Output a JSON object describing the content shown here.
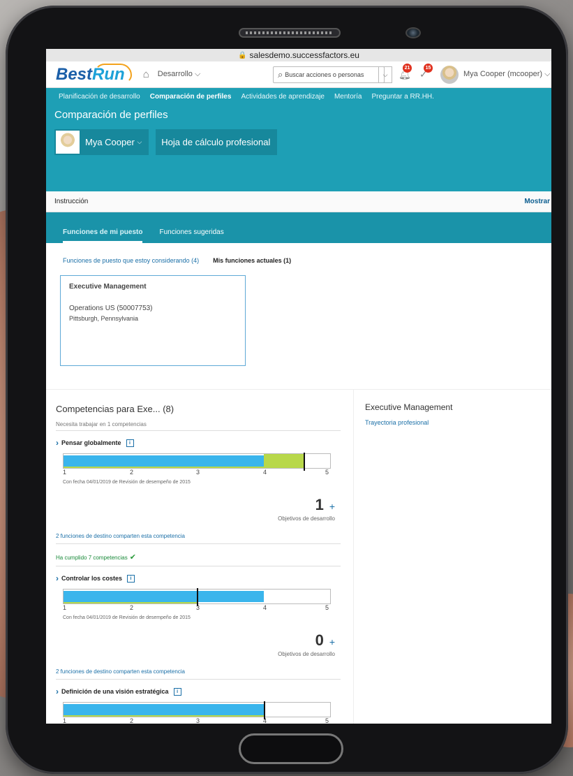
{
  "browser": {
    "url": "salesdemo.successfactors.eu"
  },
  "shell": {
    "logo_main": "Best",
    "logo_run": "Run",
    "module": "Desarrollo",
    "search_placeholder": "Buscar acciones o personas",
    "notifications_count": "21",
    "todos_count": "15",
    "user": "Mya Cooper (mcooper)"
  },
  "nav": {
    "items": [
      {
        "label": "Planificación de desarrollo"
      },
      {
        "label": "Comparación de perfiles"
      },
      {
        "label": "Actividades de aprendizaje"
      },
      {
        "label": "Mentoría"
      },
      {
        "label": "Preguntar a RR.HH."
      }
    ]
  },
  "header": {
    "title": "Comparación de perfiles",
    "person": "Mya Cooper",
    "worksheet": "Hoja de cálculo profesional"
  },
  "instruction": {
    "label": "Instrucción",
    "action": "Mostrar"
  },
  "tabs": [
    {
      "label": "Funciones de mi puesto"
    },
    {
      "label": "Funciones sugeridas"
    }
  ],
  "roles": {
    "considering": "Funciones de puesto que estoy considerando (4)",
    "current": "Mis funciones actuales (1)",
    "card": {
      "title": "Executive Management",
      "org": "Operations US (50007753)",
      "location": "Pittsburgh, Pennsylvania"
    }
  },
  "competencies": {
    "title": "Competencias para Exe...  (8)",
    "needs_work": "Necesita trabajar en 1 competencias",
    "met": "Ha cumplido 7 competencias",
    "scale": [
      "1",
      "2",
      "3",
      "4",
      "5"
    ],
    "items": [
      {
        "name": "Pensar globalmente",
        "rating": 4,
        "expected": 4.6,
        "dated": "Con fecha 04/01/2019 de Revisión de desempeño de 2015",
        "objectives": "1",
        "objectives_label": "Objetivos de desarrollo",
        "shared": "2 funciones de destino comparten esta competencia"
      },
      {
        "name": "Controlar los costes",
        "rating": 4,
        "expected": 3,
        "dated": "Con fecha 04/01/2019 de Revisión de desempeño de 2015",
        "objectives": "0",
        "objectives_label": "Objetivos de desarrollo",
        "shared": "2 funciones de destino comparten esta competencia"
      },
      {
        "name": "Definición de una visión estratégica",
        "rating": 4,
        "expected": 4
      }
    ]
  },
  "side": {
    "title": "Executive Management",
    "link": "Trayectoria profesional"
  },
  "colors": {
    "brand_teal": "#1e9fb5",
    "bar_blue": "#3ab5ec",
    "bar_green": "#b8d84a",
    "link_blue": "#1a6fa7"
  }
}
